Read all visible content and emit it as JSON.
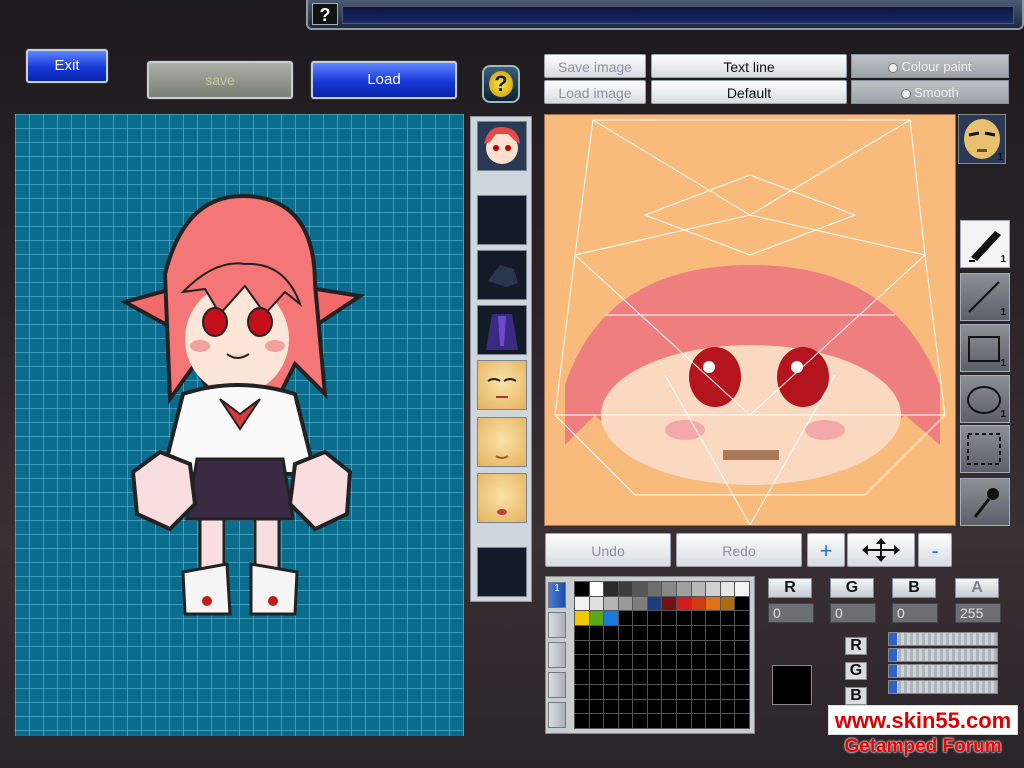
{
  "topbar": {
    "help_label": "?"
  },
  "buttons": {
    "exit": "Exit",
    "save": "save",
    "load": "Load",
    "help": "?"
  },
  "editor_menu": {
    "save_image": "Save image",
    "load_image": "Load image",
    "text_line": "Text line",
    "default": "Default",
    "colour_paint": "Colour paint",
    "smooth": "Smooth"
  },
  "edit_actions": {
    "undo": "Undo",
    "redo": "Redo",
    "plus": "+",
    "minus": "-"
  },
  "tools": [
    {
      "name": "pen",
      "count": "1"
    },
    {
      "name": "line",
      "count": "1"
    },
    {
      "name": "rectangle",
      "count": "1"
    },
    {
      "name": "ellipse",
      "count": "1"
    },
    {
      "name": "select",
      "count": ""
    },
    {
      "name": "eyedropper",
      "count": ""
    }
  ],
  "face_count": "1",
  "palette": {
    "tab_active": "1",
    "colors": [
      "#000000",
      "#ffffff",
      "#2a2a2a",
      "#3c3c3c",
      "#555555",
      "#6e6e6e",
      "#888888",
      "#a0a0a0",
      "#b8b8b8",
      "#d0d0d0",
      "#e6e6e6",
      "#f4f4f4",
      "#f2f2f2",
      "#e0e0e0",
      "#b4b4b4",
      "#9a9a9a",
      "#7e7e7e",
      "#1c3c7a",
      "#6e1414",
      "#d41c1c",
      "#d03a14",
      "#e07018",
      "#b06a10",
      "#000000",
      "#f0c800",
      "#58a818",
      "#1a7ad8",
      "#000000",
      "#000000",
      "#000000",
      "#000000",
      "#000000",
      "#000000",
      "#000000",
      "#000000",
      "#000000"
    ]
  },
  "color_channels": {
    "r_label": "R",
    "g_label": "G",
    "b_label": "B",
    "a_label": "A",
    "r": "0",
    "g": "0",
    "b": "0",
    "a": "255"
  },
  "current_color": "#000000",
  "watermark": {
    "site": "www.skin55.com",
    "forum": "Getamped Forum"
  }
}
